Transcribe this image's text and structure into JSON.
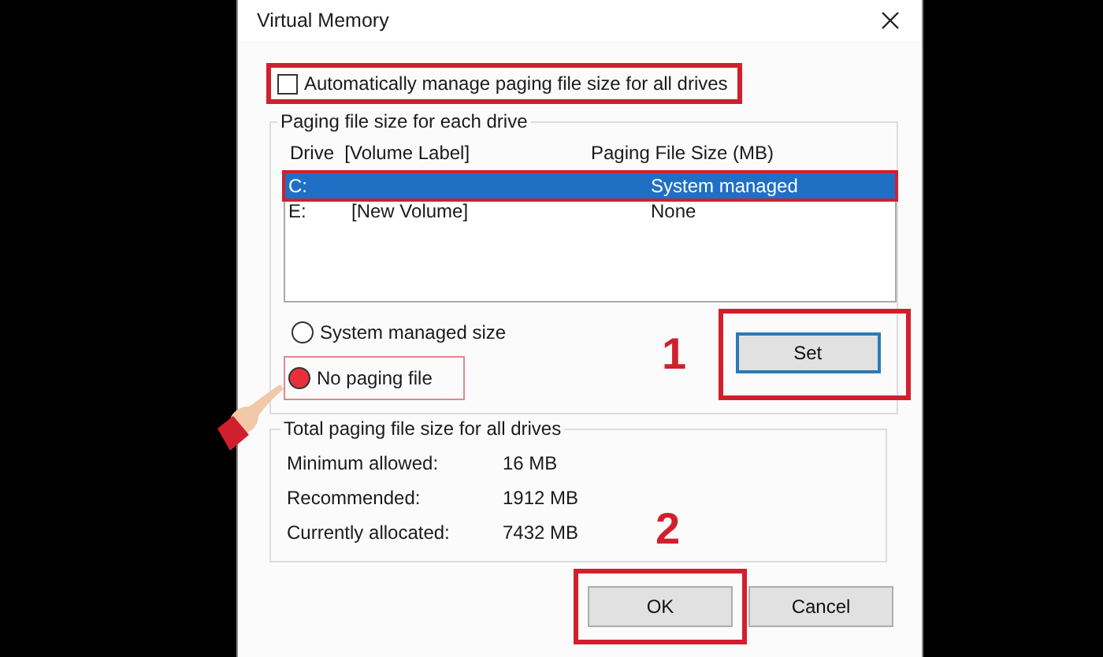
{
  "window": {
    "title": "Virtual Memory"
  },
  "auto_manage": {
    "label": "Automatically manage paging file size for all drives",
    "checked": false
  },
  "drive_group": {
    "title": "Paging file size for each drive",
    "columns": [
      "Drive  [Volume Label]",
      "Paging File Size (MB)"
    ],
    "rows": [
      {
        "drive": "C:",
        "size": "System managed",
        "selected": true
      },
      {
        "drive": "E:",
        "label": "[New Volume]",
        "size": "None",
        "selected": false
      }
    ]
  },
  "options": [
    {
      "label": "System managed size",
      "selected": false
    },
    {
      "label": "No paging file",
      "selected": true
    }
  ],
  "set_button": "Set",
  "totals": {
    "title": "Total paging file size for all drives",
    "rows": [
      {
        "label": "Minimum allowed:",
        "value": "16 MB"
      },
      {
        "label": "Recommended:",
        "value": "1912 MB"
      },
      {
        "label": "Currently allocated:",
        "value": "7432 MB"
      }
    ]
  },
  "buttons": [
    {
      "label": "OK",
      "kind": "default"
    },
    {
      "label": "Cancel",
      "kind": "normal"
    }
  ],
  "steps": [
    "1",
    "2"
  ]
}
